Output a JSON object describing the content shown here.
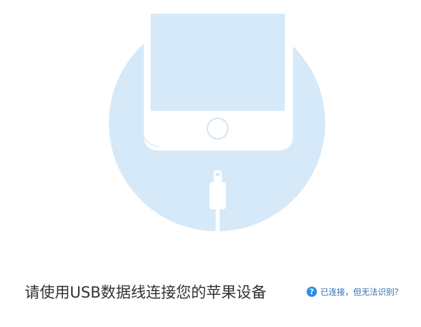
{
  "illustration": {
    "circle_color": "#d6e9f8",
    "phone_screen_color": "#d6e9f8",
    "phone_body_color": "#ffffff",
    "home_button_color": "#cfe4f6"
  },
  "main": {
    "prompt": "请使用USB数据线连接您的苹果设备"
  },
  "help": {
    "icon": "?",
    "icon_name": "question-circle-icon",
    "link_text": "已连接，但无法识别？",
    "link_color": "#2b6fb0"
  }
}
